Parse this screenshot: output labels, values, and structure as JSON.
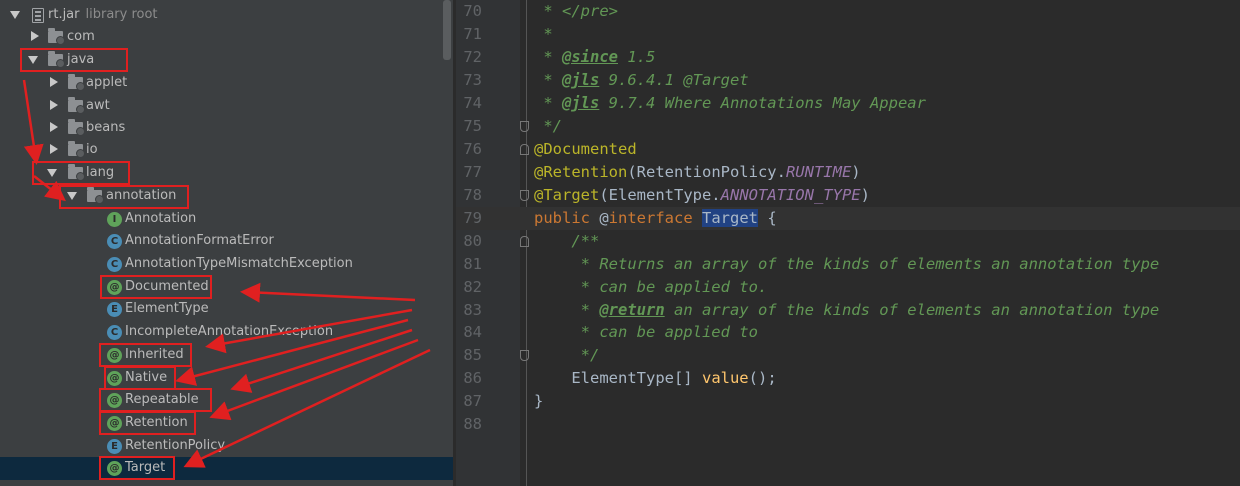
{
  "tree": {
    "root": {
      "label": "rt.jar",
      "sublabel": "library root"
    },
    "items": [
      {
        "label": "com"
      },
      {
        "label": "java"
      },
      {
        "label": "applet"
      },
      {
        "label": "awt"
      },
      {
        "label": "beans"
      },
      {
        "label": "io"
      },
      {
        "label": "lang"
      },
      {
        "label": "annotation"
      },
      {
        "label": "Annotation",
        "icon": "I"
      },
      {
        "label": "AnnotationFormatError",
        "icon": "C"
      },
      {
        "label": "AnnotationTypeMismatchException",
        "icon": "C"
      },
      {
        "label": "Documented",
        "icon": "@"
      },
      {
        "label": "ElementType",
        "icon": "E"
      },
      {
        "label": "IncompleteAnnotationException",
        "icon": "C"
      },
      {
        "label": "Inherited",
        "icon": "@"
      },
      {
        "label": "Native",
        "icon": "@"
      },
      {
        "label": "Repeatable",
        "icon": "@"
      },
      {
        "label": "Retention",
        "icon": "@"
      },
      {
        "label": "RetentionPolicy",
        "icon": "E"
      },
      {
        "label": "Target",
        "icon": "@"
      }
    ]
  },
  "editor": {
    "lines": [
      {
        "n": "70"
      },
      {
        "n": "71"
      },
      {
        "n": "72"
      },
      {
        "n": "73"
      },
      {
        "n": "74"
      },
      {
        "n": "75"
      },
      {
        "n": "76"
      },
      {
        "n": "77"
      },
      {
        "n": "78"
      },
      {
        "n": "79"
      },
      {
        "n": "80"
      },
      {
        "n": "81"
      },
      {
        "n": "82"
      },
      {
        "n": "83"
      },
      {
        "n": "84"
      },
      {
        "n": "85"
      },
      {
        "n": "86"
      },
      {
        "n": "87"
      },
      {
        "n": "88"
      }
    ],
    "code": {
      "l70": " * </pre>",
      "l71": " *",
      "l72_pre": " * ",
      "l72_tag": "@since",
      "l72_post": " 1.5",
      "l73_pre": " * ",
      "l73_tag": "@jls",
      "l73_post": " 9.6.4.1 @Target",
      "l74_pre": " * ",
      "l74_tag": "@jls",
      "l74_post": " 9.7.4 Where Annotations May Appear",
      "l75": " */",
      "l76": "@Documented",
      "l77_ann": "@Retention",
      "l77_a": "(RetentionPolicy.",
      "l77_c": "RUNTIME",
      "l77_b": ")",
      "l78_ann": "@Target",
      "l78_a": "(ElementType.",
      "l78_c": "ANNOTATION_TYPE",
      "l78_b": ")",
      "l79_kw1": "public",
      "l79_sp": " @",
      "l79_kw2": "interface",
      "l79_sp2": " ",
      "l79_name": "Target",
      "l79_end": " {",
      "l80": "    /**",
      "l81": "     * Returns an array of the kinds of elements an annotation type",
      "l82": "     * can be applied to.",
      "l83_pre": "     * ",
      "l83_tag": "@return",
      "l83_post": " an array of the kinds of elements an annotation type",
      "l84": "     * can be applied to",
      "l85": "     */",
      "l86_a": "    ElementType[] ",
      "l86_m": "value",
      "l86_b": "();",
      "l87": "}",
      "l88": ""
    }
  },
  "colors": {
    "accent_red": "#e02020",
    "selection": "#0d293e",
    "comment": "#629755",
    "keyword": "#cc7832",
    "annotation": "#bbb529"
  }
}
